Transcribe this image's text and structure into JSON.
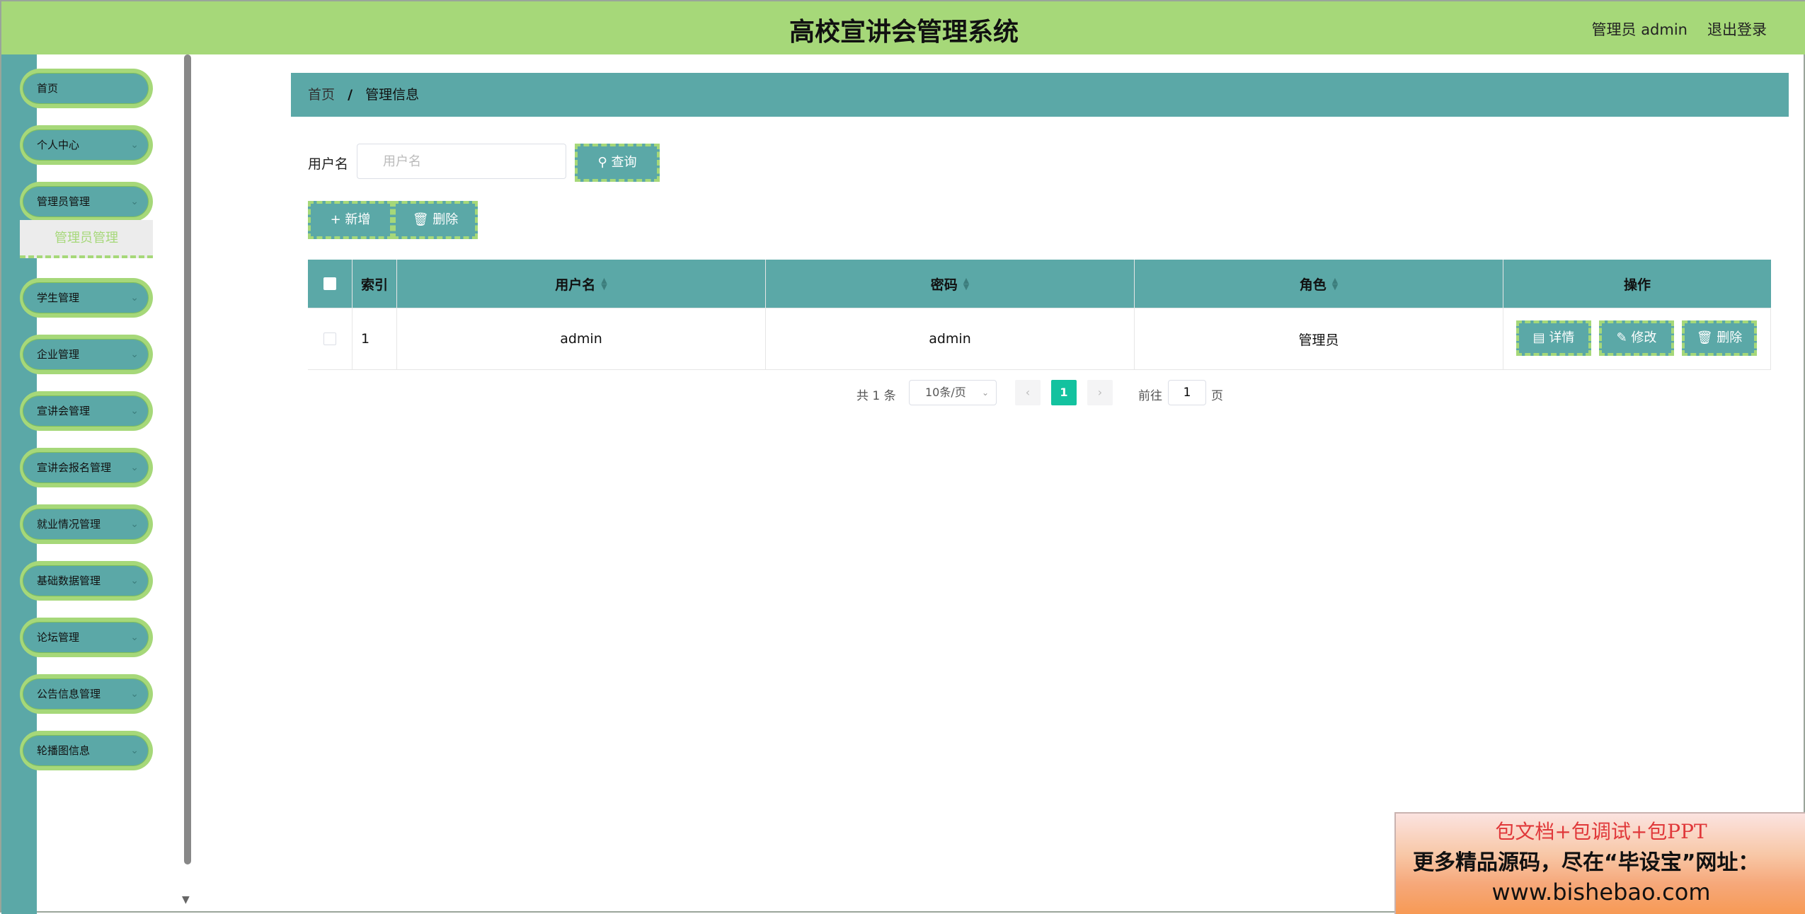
{
  "header": {
    "title": "高校宣讲会管理系统",
    "user": "管理员 admin",
    "logout": "退出登录"
  },
  "sidebar": {
    "items": [
      {
        "label": "首页",
        "has_arrow": false
      },
      {
        "label": "个人中心",
        "has_arrow": true
      },
      {
        "label": "管理员管理",
        "has_arrow": true
      },
      {
        "label": "学生管理",
        "has_arrow": true
      },
      {
        "label": "企业管理",
        "has_arrow": true
      },
      {
        "label": "宣讲会管理",
        "has_arrow": true
      },
      {
        "label": "宣讲会报名管理",
        "has_arrow": true
      },
      {
        "label": "就业情况管理",
        "has_arrow": true
      },
      {
        "label": "基础数据管理",
        "has_arrow": true
      },
      {
        "label": "论坛管理",
        "has_arrow": true
      },
      {
        "label": "公告信息管理",
        "has_arrow": true
      },
      {
        "label": "轮播图信息",
        "has_arrow": true
      }
    ],
    "sub_item": "管理员管理"
  },
  "breadcrumb": {
    "home": "首页",
    "separator": "/",
    "current": "管理信息"
  },
  "search": {
    "label": "用户名",
    "placeholder": "用户名",
    "button": "查询"
  },
  "actions": {
    "add": "新增",
    "delete": "删除"
  },
  "table": {
    "headers": {
      "index": "索引",
      "username": "用户名",
      "password": "密码",
      "role": "角色",
      "operation": "操作"
    },
    "rows": [
      {
        "index": "1",
        "username": "admin",
        "password": "admin",
        "role": "管理员"
      }
    ],
    "row_buttons": {
      "detail": "详情",
      "edit": "修改",
      "delete": "删除"
    }
  },
  "pagination": {
    "total": "共 1 条",
    "page_size": "10条/页",
    "current_page": "1",
    "goto_prefix": "前往",
    "goto_value": "1",
    "goto_suffix": "页"
  },
  "ad": {
    "line1": "包文档+包调试+包PPT",
    "line2": "更多精品源码，尽在“毕设宝”网址：",
    "line3": "www.bishebao.com"
  },
  "colors": {
    "header_bg": "#a6d879",
    "teal": "#5ba8a7",
    "page_active": "#13c29f"
  }
}
